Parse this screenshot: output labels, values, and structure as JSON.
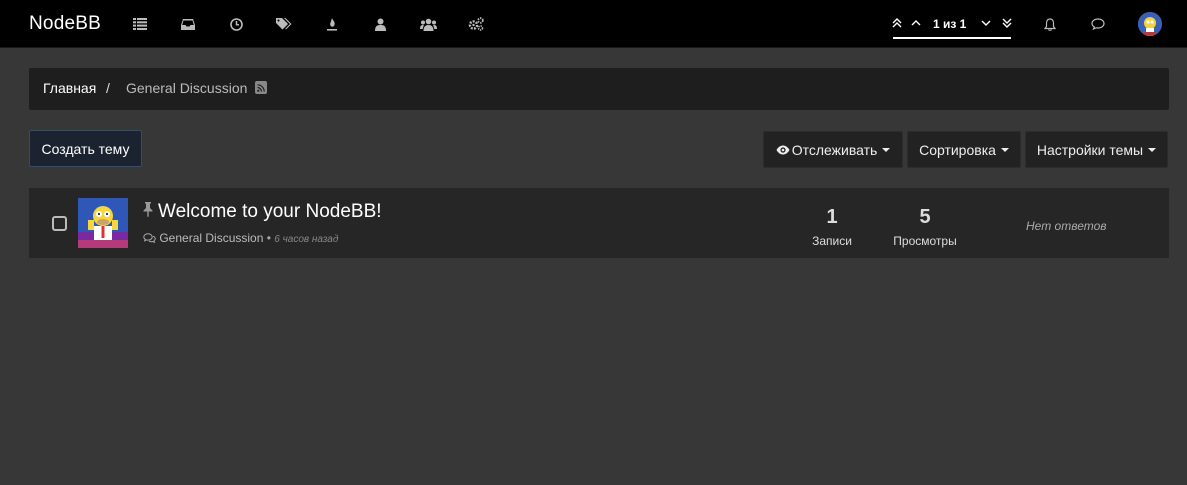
{
  "navbar": {
    "brand": "NodeBB",
    "icons": [
      "list-icon",
      "inbox-icon",
      "clock-icon",
      "tags-icon",
      "fire-icon",
      "user-icon",
      "users-icon",
      "cogs-icon"
    ],
    "pagination": {
      "text": "1 из 1"
    }
  },
  "breadcrumb": {
    "home": "Главная",
    "separator": "/",
    "current": "General Discussion"
  },
  "toolbar": {
    "create_label": "Создать тему",
    "watch_label": "Отслеживать",
    "sort_label": "Сортировка",
    "settings_label": "Настройки темы"
  },
  "topics": [
    {
      "title": "Welcome to your NodeBB!",
      "category": "General Discussion",
      "time": "6 часов назад",
      "posts": "1",
      "posts_label": "Записи",
      "views": "5",
      "views_label": "Просмотры",
      "no_replies": "Нет ответов"
    }
  ],
  "colors": {
    "background": "#373737",
    "navbar": "#000000",
    "panel": "#262626",
    "accent": "#3c4b62"
  }
}
